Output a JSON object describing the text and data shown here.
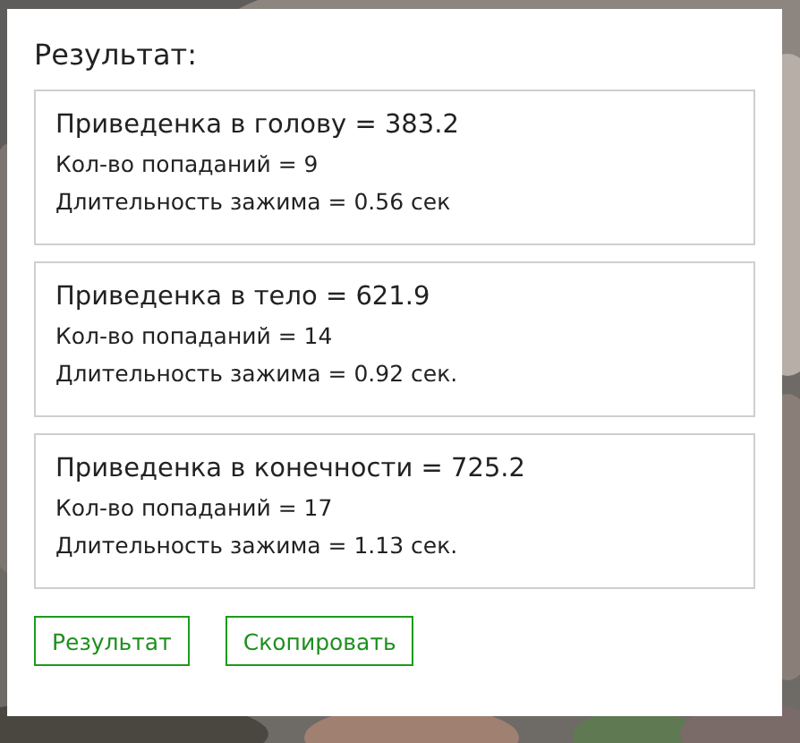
{
  "title": "Результат:",
  "results": [
    {
      "heading": "Приведенка в голову = 383.2",
      "lines": [
        "Кол-во попаданий = 9",
        "Длительность зажима = 0.56 сек"
      ]
    },
    {
      "heading": "Приведенка в тело = 621.9",
      "lines": [
        "Кол-во попаданий = 14",
        "Длительность зажима = 0.92 сек."
      ]
    },
    {
      "heading": "Приведенка в конечности = 725.2",
      "lines": [
        "Кол-во попаданий = 17",
        "Длительность зажима = 1.13 сек."
      ]
    }
  ],
  "buttons": [
    "Результат",
    "Скопировать"
  ]
}
